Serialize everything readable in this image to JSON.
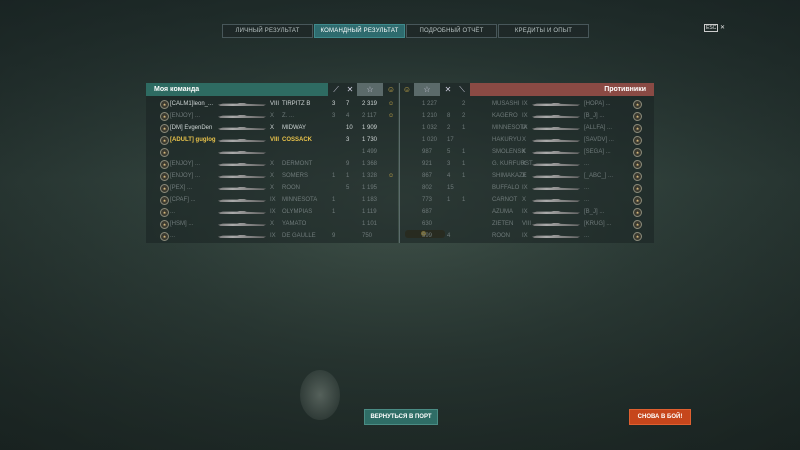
{
  "tabs": [
    {
      "label": "ЛИЧНЫЙ РЕЗУЛЬТАТ",
      "active": false
    },
    {
      "label": "КОМАНДНЫЙ РЕЗУЛЬТАТ",
      "active": true
    },
    {
      "label": "ПОДРОБНЫЙ ОТЧЁТ",
      "active": false
    },
    {
      "label": "КРЕДИТЫ И ОПЫТ",
      "active": false
    }
  ],
  "esc": {
    "key": "ESC",
    "close": "✕"
  },
  "my_team": {
    "title": "Моя команда",
    "col_icons": [
      "torpedo-icon",
      "planes-icon",
      "xp-star-icon",
      "medal-icon"
    ],
    "players": [
      {
        "name": "[CALM1]leon_...",
        "tier": "VIII",
        "ship": "TIRPITZ B",
        "torp": "3",
        "kills": "7",
        "xp": "2 319",
        "medal": "☺",
        "dim": false,
        "me": false
      },
      {
        "name": "[ENJOY] ...",
        "tier": "X",
        "ship": "Z. ...",
        "torp": "3",
        "kills": "4",
        "xp": "2 117",
        "medal": "☺",
        "dim": true,
        "me": false
      },
      {
        "name": "[DM] EvgenDen",
        "tier": "X",
        "ship": "MIDWAY",
        "torp": "",
        "kills": "10",
        "xp": "1 909",
        "medal": "",
        "dim": false,
        "me": false
      },
      {
        "name": "[ADULT] guglog",
        "tier": "VIII",
        "ship": "COSSACK",
        "torp": "",
        "kills": "3",
        "xp": "1 730",
        "medal": "",
        "dim": false,
        "me": true
      },
      {
        "name": "",
        "tier": "",
        "ship": "",
        "torp": "",
        "kills": "",
        "xp": "1 499",
        "medal": "",
        "dim": true,
        "me": false
      },
      {
        "name": "[ENJOY] ...",
        "tier": "X",
        "ship": "DERMONT",
        "torp": "",
        "kills": "9",
        "xp": "1 368",
        "medal": "",
        "dim": true,
        "me": false
      },
      {
        "name": "[ENJOY] ...",
        "tier": "X",
        "ship": "SOMERS",
        "torp": "1",
        "kills": "1",
        "xp": "1 328",
        "medal": "☺",
        "dim": true,
        "me": false
      },
      {
        "name": "[PEX] ...",
        "tier": "X",
        "ship": "ROON",
        "torp": "",
        "kills": "5",
        "xp": "1 195",
        "medal": "",
        "dim": true,
        "me": false
      },
      {
        "name": "[CPAF] ...",
        "tier": "IX",
        "ship": "MINNESOTA",
        "torp": "1",
        "kills": "",
        "xp": "1 183",
        "medal": "",
        "dim": true,
        "me": false
      },
      {
        "name": "...",
        "tier": "IX",
        "ship": "OLYMPIAS",
        "torp": "1",
        "kills": "",
        "xp": "1 119",
        "medal": "",
        "dim": true,
        "me": false
      },
      {
        "name": "[HSM] ...",
        "tier": "X",
        "ship": "YAMATO",
        "torp": "",
        "kills": "",
        "xp": "1 101",
        "medal": "",
        "dim": true,
        "me": false
      },
      {
        "name": "...",
        "tier": "IX",
        "ship": "DE GAULLE",
        "torp": "9",
        "kills": "",
        "xp": "750",
        "medal": "",
        "dim": true,
        "me": false
      }
    ]
  },
  "enemies": {
    "title": "Противники",
    "players": [
      {
        "xp": "1 227",
        "kills": "",
        "torp": "2",
        "ship": "MUSASHI",
        "tier": "IX",
        "name": "[HOPA] ...",
        "dim": true
      },
      {
        "xp": "1 210",
        "kills": "8",
        "torp": "2",
        "ship": "KAGERO",
        "tier": "IX",
        "name": "[B_J] ...",
        "dim": true
      },
      {
        "xp": "1 032",
        "kills": "2",
        "torp": "1",
        "ship": "MINNESOTA",
        "tier": "IX",
        "name": "[ALLFA] ...",
        "dim": true
      },
      {
        "xp": "1 020",
        "kills": "17",
        "torp": "",
        "ship": "HAKURYU",
        "tier": "X",
        "name": "[SAVDV] ...",
        "dim": true
      },
      {
        "xp": "987",
        "kills": "5",
        "torp": "1",
        "ship": "SMOLENSK",
        "tier": "X",
        "name": "[SEGA] ...",
        "dim": true
      },
      {
        "xp": "921",
        "kills": "3",
        "torp": "1",
        "ship": "G. KURFURST",
        "tier": "X",
        "name": "...",
        "dim": true
      },
      {
        "xp": "867",
        "kills": "4",
        "torp": "1",
        "ship": "SHIMAKAZE",
        "tier": "X",
        "name": "[_ABC_] ...",
        "dim": true
      },
      {
        "xp": "802",
        "kills": "15",
        "torp": "",
        "ship": "BUFFALO",
        "tier": "IX",
        "name": "...",
        "dim": true
      },
      {
        "xp": "773",
        "kills": "1",
        "torp": "1",
        "ship": "CARNOT",
        "tier": "X",
        "name": "...",
        "dim": true
      },
      {
        "xp": "687",
        "kills": "",
        "torp": "",
        "ship": "AZUMA",
        "tier": "IX",
        "name": "[B_J] ...",
        "dim": true
      },
      {
        "xp": "630",
        "kills": "",
        "torp": "",
        "ship": "ZIETEN",
        "tier": "VIII",
        "name": "[KRUG] ...",
        "dim": true
      },
      {
        "xp": "599",
        "kills": "4",
        "torp": "",
        "ship": "ROON",
        "tier": "IX",
        "name": "...",
        "dim": true
      }
    ]
  },
  "buttons": {
    "port": "ВЕРНУТЬСЯ В ПОРТ",
    "battle": "СНОВА В БОЙ!"
  }
}
